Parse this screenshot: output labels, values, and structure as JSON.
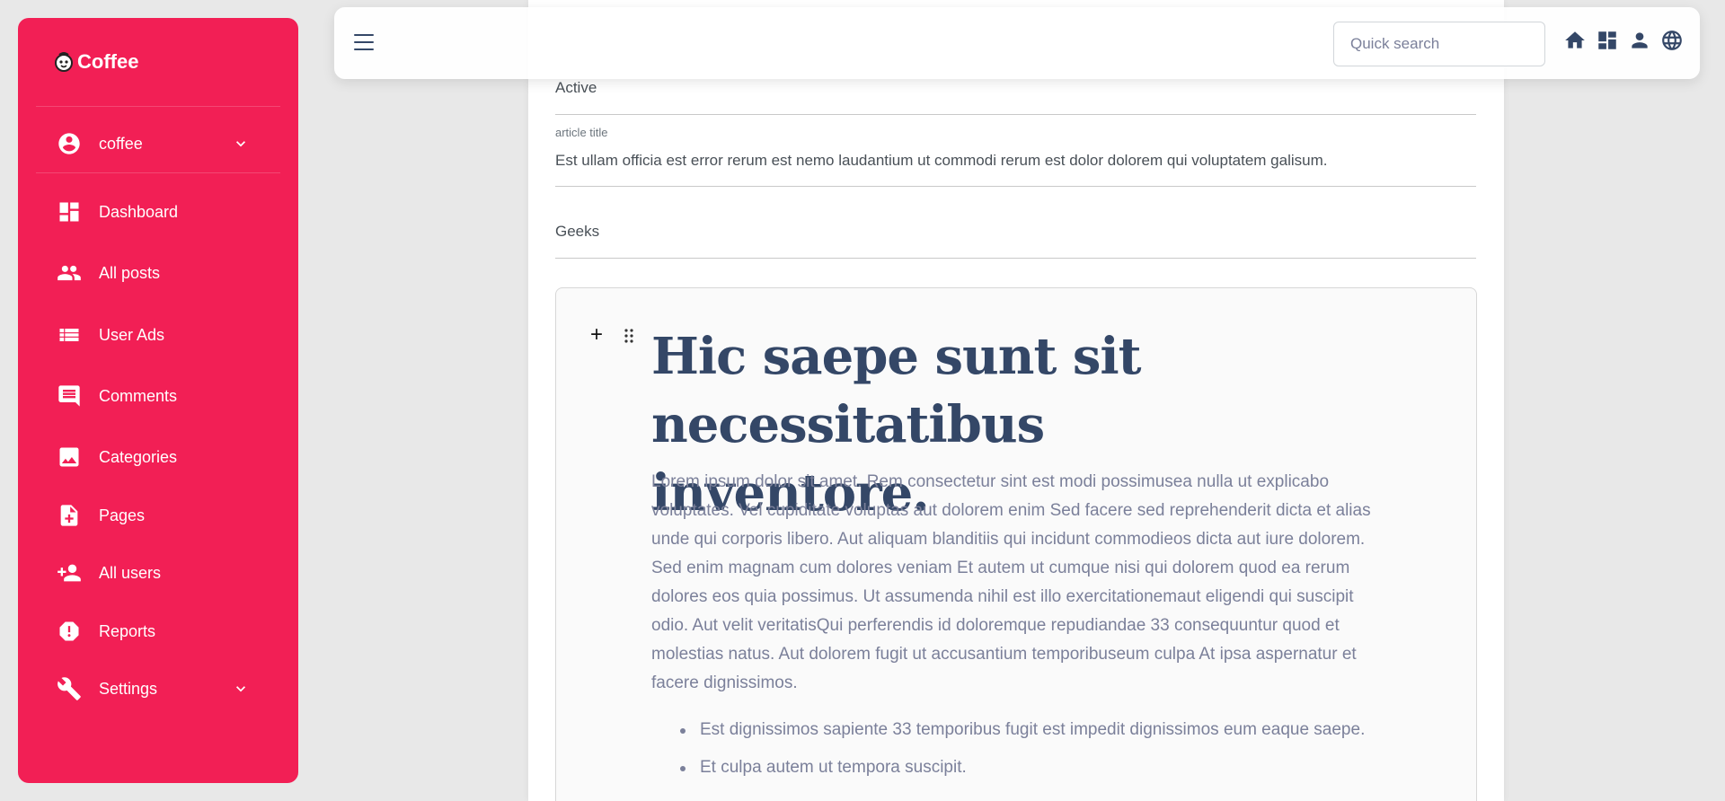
{
  "sidebar": {
    "brand": "Coffee",
    "user": {
      "name": "coffee"
    },
    "items": [
      {
        "label": "Dashboard",
        "icon": "dashboard-icon"
      },
      {
        "label": "All posts",
        "icon": "group-icon"
      },
      {
        "label": "User Ads",
        "icon": "list-icon"
      },
      {
        "label": "Comments",
        "icon": "comment-icon"
      },
      {
        "label": "Categories",
        "icon": "image-icon"
      },
      {
        "label": "Pages",
        "icon": "note-add-icon"
      },
      {
        "label": "All users",
        "icon": "person-add-icon"
      },
      {
        "label": "Reports",
        "icon": "report-icon"
      },
      {
        "label": "Settings",
        "icon": "wrench-icon"
      }
    ],
    "accent": "#f21f55"
  },
  "topbar": {
    "search_placeholder": "Quick search",
    "icons": [
      "home-icon",
      "dashboard-icon",
      "person-icon",
      "globe-icon"
    ]
  },
  "form": {
    "status": "Active",
    "title_label": "article title",
    "title_value": "Est ullam officia est error rerum est nemo laudantium ut commodi rerum est dolor dolorem qui voluptatem galisum.",
    "category": "Geeks"
  },
  "editor": {
    "heading": "Hic saepe sunt sit necessitatibus inventore.",
    "paragraph": "Lorem ipsum dolor sit amet. Rem consectetur sint est modi possimusea nulla ut explicabo voluptates. Vel cupiditate voluptas aut dolorem enim Sed facere sed reprehenderit dicta et alias unde qui corporis libero. Aut aliquam blanditiis qui incidunt commodieos dicta aut iure dolorem. Sed enim magnam cum dolores veniam Et autem ut cumque nisi qui dolorem quod ea rerum dolores eos quia possimus. Ut assumenda nihil est illo exercitationemaut eligendi qui suscipit odio. Aut velit veritatisQui perferendis id doloremque repudiandae 33 consequuntur quod et molestias natus. Aut dolorem fugit ut accusantium temporibuseum culpa At ipsa aspernatur et facere dignissimos.",
    "list": [
      "Est dignissimos sapiente 33 temporibus fugit est impedit dignissimos eum eaque saepe.",
      "Et culpa autem ut tempora suscipit."
    ],
    "heading_color": "#344767",
    "text_color": "#7b809a"
  }
}
